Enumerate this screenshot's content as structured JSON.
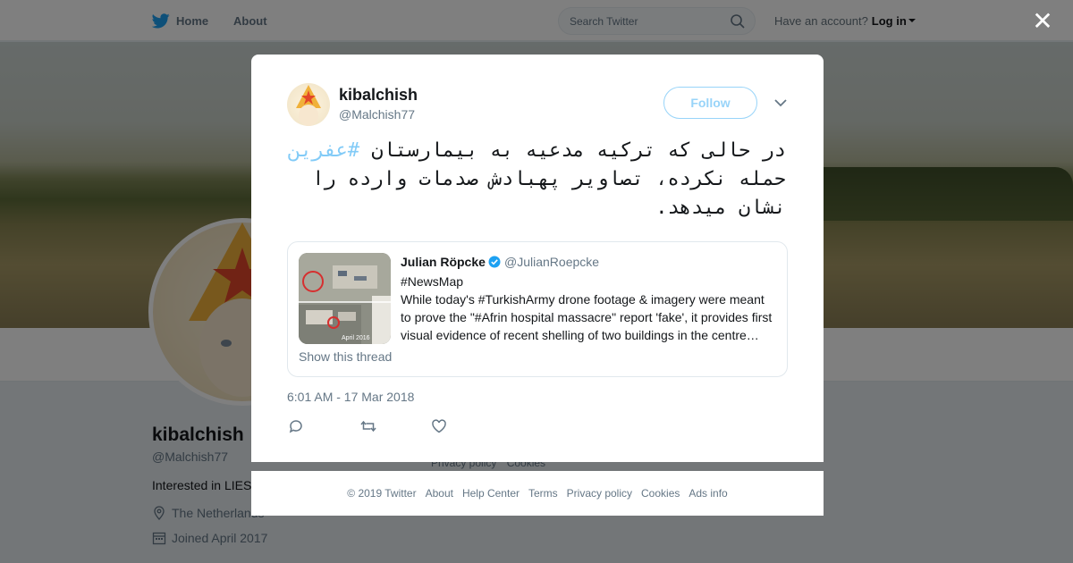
{
  "topbar": {
    "home_label": "Home",
    "about_label": "About",
    "search_placeholder": "Search Twitter",
    "account_prompt": "Have an account?",
    "login_label": "Log in"
  },
  "profile": {
    "name": "kibalchish",
    "handle": "@Malchish77",
    "bio": "Interested in LIES",
    "location": "The Netherlands",
    "joined": "Joined April 2017",
    "links": [
      "Privacy policy",
      "Cookies"
    ]
  },
  "tweet": {
    "author_name": "kibalchish",
    "author_handle": "@Malchish77",
    "follow_label": "Follow",
    "text_before": "در حالی که ترکیه مدعیه به بیمارستان ",
    "hashtag": "#عفرین",
    "text_after": " حمله نکرده، تصاویر پهبادش صدمات وارده را نشان میدهد.",
    "timestamp": "6:01 AM - 17 Mar 2018"
  },
  "quoted": {
    "name": "Julian Röpcke",
    "handle": "@JulianRoepcke",
    "lines": [
      "#NewsMap",
      "While today's #TurkishArmy drone footage & imagery were meant",
      "to prove the \"#Afrin hospital massacre\" report 'fake', it provides first",
      "visual evidence of recent shelling of two buildings in the centre…"
    ],
    "thumb_caption": "April 2016",
    "thread_label": "Show this thread"
  },
  "footer": {
    "items": [
      "© 2019 Twitter",
      "About",
      "Help Center",
      "Terms",
      "Privacy policy",
      "Cookies",
      "Ads info"
    ]
  },
  "colors": {
    "brand": "#1da1f2",
    "muted": "#657786"
  }
}
